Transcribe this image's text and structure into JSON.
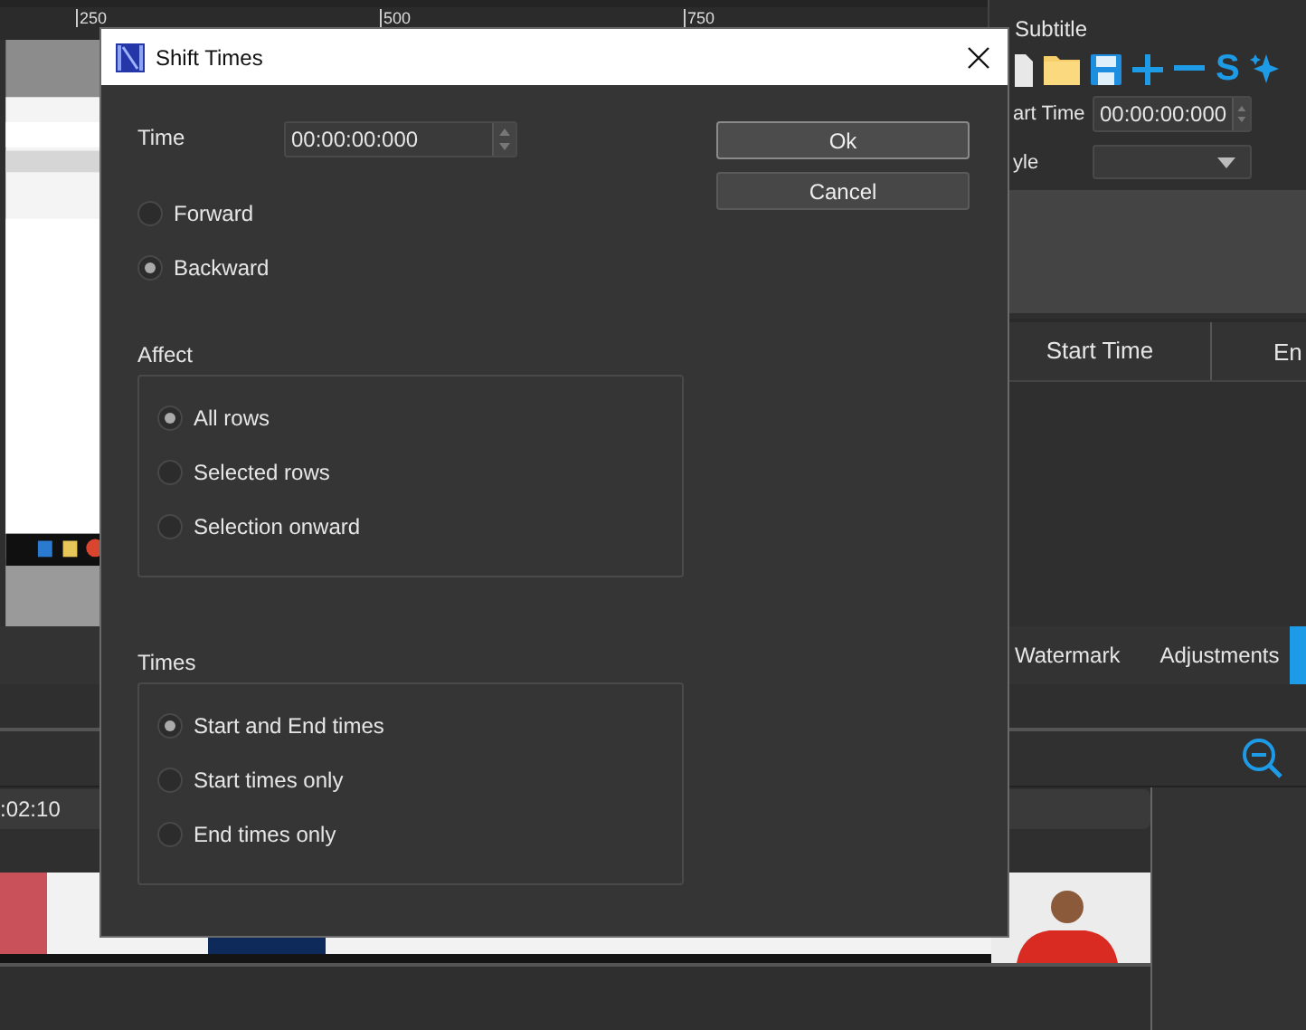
{
  "background": {
    "ruler_labels": [
      "250",
      "500",
      "750"
    ],
    "subtitle_panel": {
      "title": "Subtitle",
      "toolbar": [
        {
          "kind": "document"
        },
        {
          "kind": "folder"
        },
        {
          "kind": "save"
        },
        {
          "kind": "plus"
        },
        {
          "kind": "minus"
        },
        {
          "kind": "letter",
          "text": "S"
        },
        {
          "kind": "sparkle"
        }
      ],
      "start_time_label": "art Time",
      "start_time_value": "00:00:00:000",
      "style_label": "yle",
      "columns": [
        "Start Time",
        "En"
      ]
    },
    "tabs": [
      {
        "label": "Watermark",
        "selected": false
      },
      {
        "label": "Adjustments",
        "selected": false
      },
      {
        "selected": true
      }
    ],
    "timeline_time": ":02:10"
  },
  "window": {
    "title": "Shift Times"
  },
  "time": {
    "label": "Time",
    "value": "00:00:00:000"
  },
  "buttons": [
    {
      "label": "Ok",
      "default": true
    },
    {
      "label": "Cancel",
      "default": false
    }
  ],
  "direction": [
    {
      "label": "Forward",
      "selected": false
    },
    {
      "label": "Backward",
      "selected": true
    }
  ],
  "affect": {
    "title": "Affect",
    "options": [
      {
        "label": "All rows",
        "selected": true
      },
      {
        "label": "Selected rows",
        "selected": false
      },
      {
        "label": "Selection onward",
        "selected": false
      }
    ]
  },
  "times": {
    "title": "Times",
    "options": [
      {
        "label": "Start and End times",
        "selected": true
      },
      {
        "label": "Start times only",
        "selected": false
      },
      {
        "label": "End times only",
        "selected": false
      }
    ]
  }
}
